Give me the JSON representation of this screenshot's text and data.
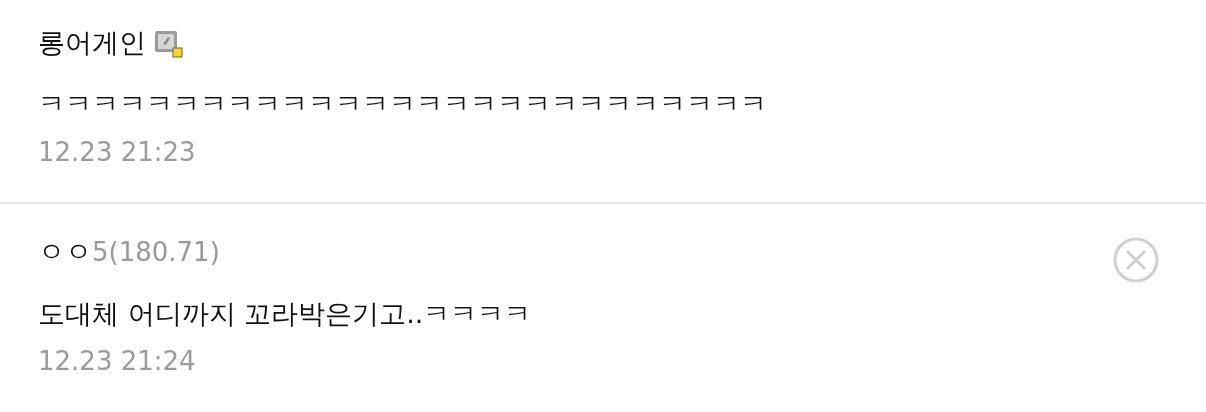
{
  "comments": [
    {
      "kind": "member",
      "author": "롱어게인",
      "text": "ㅋㅋㅋㅋㅋㅋㅋㅋㅋㅋㅋㅋㅋㅋㅋㅋㅋㅋㅋㅋㅋㅋㅋㅋㅋㅋㅋ",
      "date": "12.23 21:23"
    },
    {
      "kind": "guest",
      "author": "ㅇㅇ",
      "ip": "5(180.71)",
      "text": "도대체 어디까지 꼬라박은기고..ㅋㅋㅋㅋ",
      "date": "12.23 21:24"
    }
  ]
}
